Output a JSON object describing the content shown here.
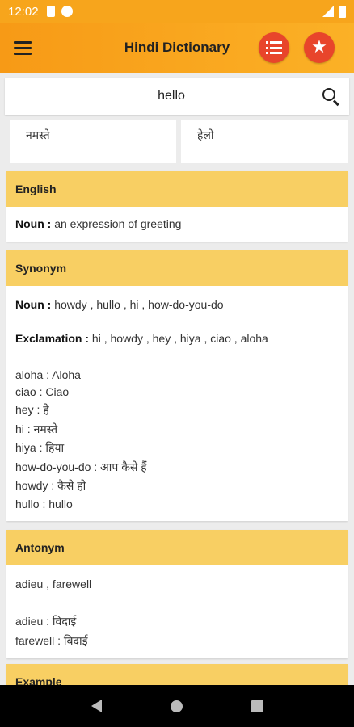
{
  "status": {
    "time": "12:02"
  },
  "app": {
    "title": "Hindi Dictionary"
  },
  "search": {
    "value": "hello"
  },
  "translations": [
    "नमस्ते",
    "हेलो"
  ],
  "english": {
    "header": "English",
    "pos": "Noun :",
    "definition": " an expression of greeting"
  },
  "synonym": {
    "header": "Synonym",
    "lines": [
      {
        "label": "Noun :",
        "text": " howdy , hullo , hi , how-do-you-do"
      },
      {
        "label": "Exclamation :",
        "text": " hi , howdy , hey , hiya , ciao , aloha"
      }
    ],
    "map": [
      "aloha : Aloha",
      "ciao : Ciao",
      "hey : हे",
      "hi : नमस्ते",
      "hiya : हिया",
      "how-do-you-do : आप कैसे हैं",
      "howdy : कैसे हो",
      "hullo : hullo"
    ]
  },
  "antonym": {
    "header": "Antonym",
    "list": "adieu , farewell",
    "map": [
      "adieu : विदाई",
      "farewell : बिदाई"
    ]
  },
  "example": {
    "header": "Example"
  },
  "colors": {
    "appbar": "#f79a16",
    "card_header": "#f8cf63",
    "action_button": "#e8452b"
  }
}
